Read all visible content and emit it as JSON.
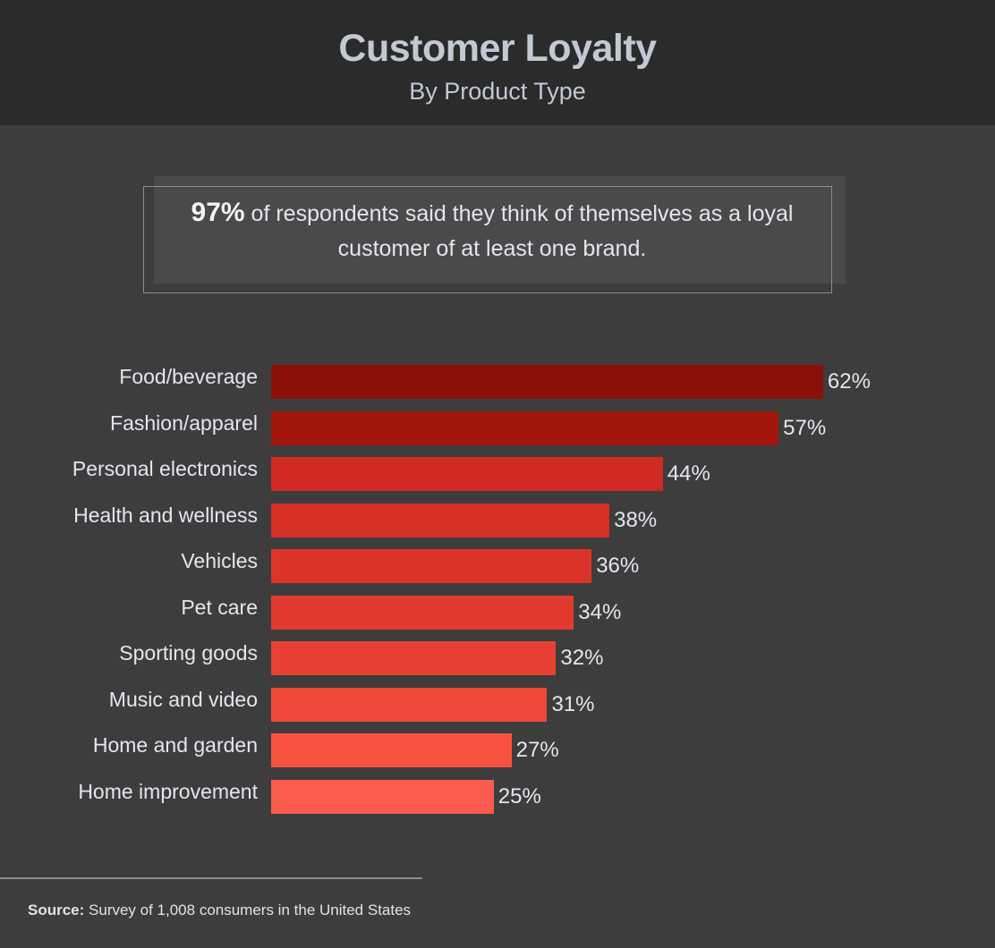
{
  "header": {
    "title": "Customer Loyalty",
    "subtitle": "By Product Type"
  },
  "callout": {
    "highlight": "97%",
    "text": " of respondents said they think of themselves as a loyal customer of at least one brand."
  },
  "footer": {
    "source_label": "Source:",
    "source_text": " Survey of 1,008 consumers in the United States"
  },
  "colors": {
    "header_background": "#2b2b2b",
    "body_background": "#3d3d3d",
    "callout_fill": "#4a4a4a",
    "callout_border": "#8d8d8d",
    "text": "#e3e7ef",
    "title_text": "#c2c9d4",
    "rule": "#8d8d8d"
  },
  "chart_data": {
    "type": "bar",
    "orientation": "horizontal",
    "title": "Customer Loyalty",
    "subtitle": "By Product Type",
    "xlabel": "",
    "ylabel": "",
    "xlim": [
      0,
      62
    ],
    "grid": false,
    "legend": "none",
    "value_suffix": "%",
    "categories": [
      "Food/beverage",
      "Fashion/apparel",
      "Personal electronics",
      "Health and wellness",
      "Vehicles",
      "Pet care",
      "Sporting goods",
      "Music and video",
      "Home and garden",
      "Home improvement"
    ],
    "values": [
      62,
      57,
      44,
      38,
      36,
      34,
      32,
      31,
      27,
      25
    ],
    "value_labels": [
      "62%",
      "57%",
      "44%",
      "38%",
      "36%",
      "34%",
      "32%",
      "31%",
      "27%",
      "25%"
    ],
    "bar_colors": [
      "#8b1005",
      "#a2160b",
      "#d02a22",
      "#d62f26",
      "#dd3429",
      "#e23a2e",
      "#ea4034",
      "#ef473a",
      "#f8513f",
      "#fb5a4e"
    ]
  }
}
